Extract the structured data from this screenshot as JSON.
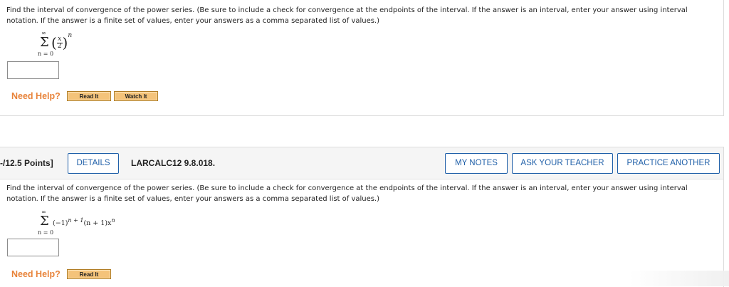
{
  "q1": {
    "instructions": "Find the interval of convergence of the power series. (Be sure to include a check for convergence at the endpoints of the interval. If the answer is an interval, enter your answer using interval notation. If the answer is a finite set of values, enter your answers as a comma separated list of values.)",
    "sum_upper": "∞",
    "sum_lower": "n = 0",
    "frac_num": "x",
    "frac_den": "2",
    "exponent": "n",
    "answer_value": "",
    "need_help": "Need Help?",
    "read_it": "Read It",
    "watch_it": "Watch It"
  },
  "q2": {
    "points": "-/12.5 Points]",
    "details": "DETAILS",
    "problem_id": "LARCALC12 9.8.018.",
    "my_notes": "MY NOTES",
    "ask_teacher": "ASK YOUR TEACHER",
    "practice_another": "PRACTICE ANOTHER",
    "instructions": "Find the interval of convergence of the power series. (Be sure to include a check for convergence at the endpoints of the interval. If the answer is an interval, enter your answer using interval notation. If the answer is a finite set of values, enter your answers as a comma separated list of values.)",
    "sum_upper": "∞",
    "sum_lower": "n = 0",
    "term_base": "(−1)",
    "term_exp": "n + 1",
    "term_rest": "(n + 1)x",
    "term_rest_exp": "n",
    "answer_value": "",
    "need_help": "Need Help?",
    "read_it": "Read It"
  },
  "colors": {
    "accent_blue": "#1f5fa8",
    "help_orange": "#e8833a",
    "help_button": "#f4c37a"
  }
}
